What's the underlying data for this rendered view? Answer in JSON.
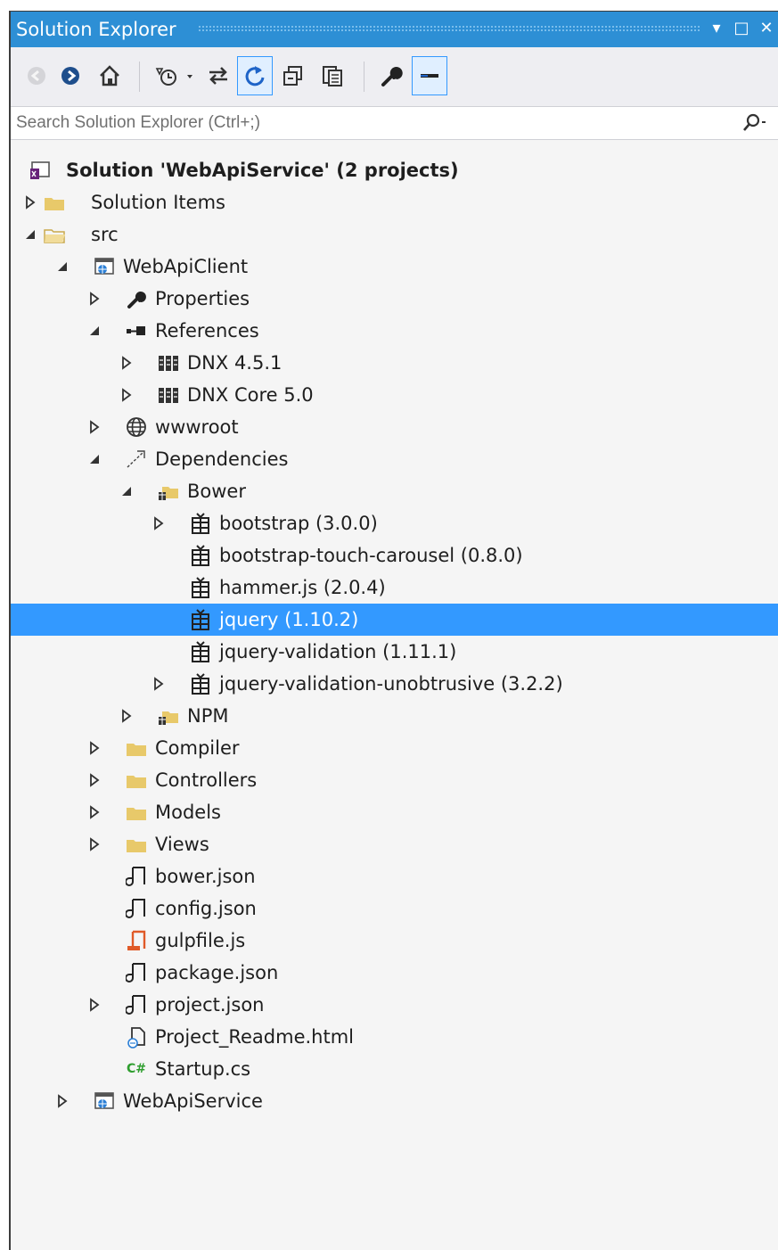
{
  "window": {
    "title": "Solution Explorer",
    "pin_label": "▾",
    "maximize_label": "□",
    "close_label": "✕"
  },
  "search": {
    "placeholder": "Search Solution Explorer (Ctrl+;)",
    "value": ""
  },
  "toolbar": {
    "buttons": [
      "back",
      "forward",
      "home",
      "pending-changes-filter",
      "sync-with-active-document",
      "refresh",
      "collapse-all",
      "show-all-files",
      "properties",
      "preview-selected-items"
    ],
    "active_button": "refresh"
  },
  "colors": {
    "title_bar": "#2d8fd5",
    "selection": "#3399ff",
    "folder": "#e8c96a",
    "gulp_icon": "#e05a28",
    "csharp_icon": "#2f9e2f"
  },
  "tree": {
    "items": [
      {
        "label": "Solution 'WebApiService' (2 projects)",
        "icon": "solution-icon",
        "expander": "none",
        "bold": true
      },
      {
        "label": "Solution Items",
        "icon": "folder-icon",
        "expander": "collapsed"
      },
      {
        "label": "src",
        "icon": "open-folder-icon",
        "expander": "expanded"
      },
      {
        "label": "WebApiClient",
        "icon": "web-project-icon",
        "expander": "expanded"
      },
      {
        "label": "Properties",
        "icon": "wrench-icon",
        "expander": "collapsed"
      },
      {
        "label": "References",
        "icon": "references-icon",
        "expander": "expanded"
      },
      {
        "label": "DNX 4.5.1",
        "icon": "framework-icon",
        "expander": "collapsed"
      },
      {
        "label": "DNX Core 5.0",
        "icon": "framework-icon",
        "expander": "collapsed"
      },
      {
        "label": "wwwroot",
        "icon": "globe-icon",
        "expander": "collapsed"
      },
      {
        "label": "Dependencies",
        "icon": "dependencies-icon",
        "expander": "expanded"
      },
      {
        "label": "Bower",
        "icon": "package-folder-icon",
        "expander": "expanded"
      },
      {
        "label": "bootstrap (3.0.0)",
        "icon": "package-icon",
        "expander": "collapsed"
      },
      {
        "label": "bootstrap-touch-carousel (0.8.0)",
        "icon": "package-icon",
        "expander": "none"
      },
      {
        "label": "hammer.js (2.0.4)",
        "icon": "package-icon",
        "expander": "none"
      },
      {
        "label": "jquery (1.10.2)",
        "icon": "package-icon",
        "expander": "none",
        "selected": true
      },
      {
        "label": "jquery-validation (1.11.1)",
        "icon": "package-icon",
        "expander": "none"
      },
      {
        "label": "jquery-validation-unobtrusive (3.2.2)",
        "icon": "package-icon",
        "expander": "collapsed"
      },
      {
        "label": "NPM",
        "icon": "package-folder-icon",
        "expander": "collapsed"
      },
      {
        "label": "Compiler",
        "icon": "folder-icon",
        "expander": "collapsed"
      },
      {
        "label": "Controllers",
        "icon": "folder-icon",
        "expander": "collapsed"
      },
      {
        "label": "Models",
        "icon": "folder-icon",
        "expander": "collapsed"
      },
      {
        "label": "Views",
        "icon": "folder-icon",
        "expander": "collapsed"
      },
      {
        "label": "bower.json",
        "icon": "json-file-icon",
        "expander": "none"
      },
      {
        "label": "config.json",
        "icon": "json-file-icon",
        "expander": "none"
      },
      {
        "label": "gulpfile.js",
        "icon": "js-file-icon",
        "expander": "none"
      },
      {
        "label": "package.json",
        "icon": "json-file-icon",
        "expander": "none"
      },
      {
        "label": "project.json",
        "icon": "json-file-icon",
        "expander": "collapsed"
      },
      {
        "label": "Project_Readme.html",
        "icon": "html-file-icon",
        "expander": "none"
      },
      {
        "label": "Startup.cs",
        "icon": "csharp-file-icon",
        "expander": "none"
      },
      {
        "label": "WebApiService",
        "icon": "web-project-icon",
        "expander": "collapsed"
      }
    ]
  }
}
